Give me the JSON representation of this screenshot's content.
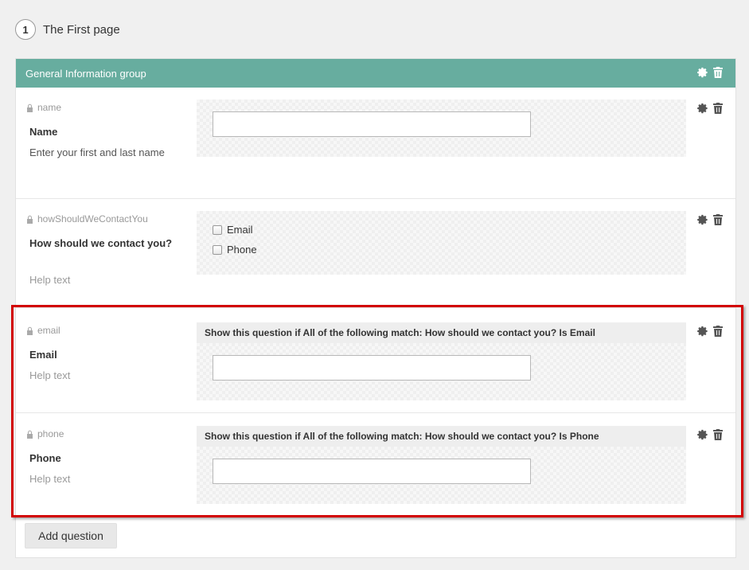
{
  "page": {
    "number": "1",
    "title": "The First page"
  },
  "group": {
    "title": "General Information group"
  },
  "questions": [
    {
      "key": "name",
      "label": "Name",
      "help": "Enter your first and last name"
    },
    {
      "key": "howShouldWeContactYou",
      "label": "How should we contact you?",
      "help": "Help text",
      "options": [
        "Email",
        "Phone"
      ]
    },
    {
      "key": "email",
      "label": "Email",
      "help": "Help text",
      "condition": "Show this question if All of the following match: How should we contact you? Is Email"
    },
    {
      "key": "phone",
      "label": "Phone",
      "help": "Help text",
      "condition": "Show this question if All of the following match: How should we contact you? Is Phone"
    }
  ],
  "add_question_label": "Add question",
  "colors": {
    "group_header": "#67ad9f",
    "highlight": "#d20000"
  }
}
